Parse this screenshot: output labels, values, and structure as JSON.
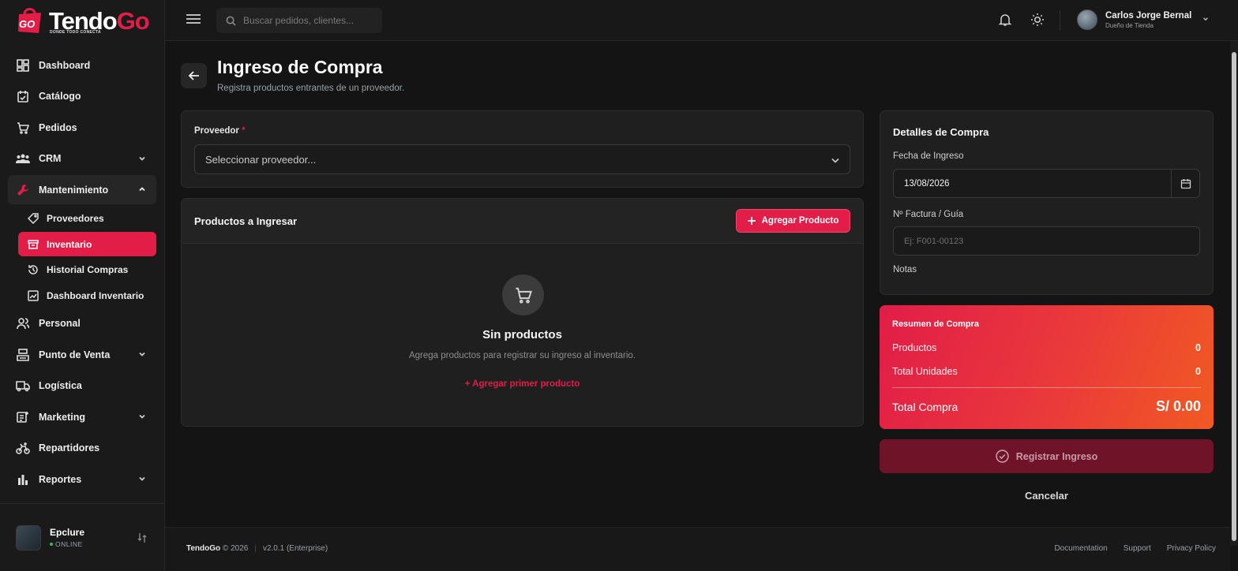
{
  "brand": {
    "name_a": "Tendo",
    "name_b": "Go",
    "badge": "GO",
    "tagline": "DONDE TODO CONECTA"
  },
  "topbar": {
    "search_placeholder": "Buscar pedidos, clientes...",
    "user_name": "Carlos Jorge Bernal",
    "user_role": "Dueño de Tienda"
  },
  "sidebar": {
    "items": [
      {
        "label": "Dashboard",
        "icon": "dashboard-icon"
      },
      {
        "label": "Catálogo",
        "icon": "catalog-icon"
      },
      {
        "label": "Pedidos",
        "icon": "cart-icon"
      },
      {
        "label": "CRM",
        "icon": "users-icon"
      },
      {
        "label": "Mantenimiento",
        "icon": "wrench-icon"
      }
    ],
    "sub_items": [
      {
        "label": "Proveedores",
        "icon": "tag-icon"
      },
      {
        "label": "Inventario",
        "icon": "archive-icon"
      },
      {
        "label": "Historial Compras",
        "icon": "history-icon"
      },
      {
        "label": "Dashboard Inventario",
        "icon": "chart-icon"
      }
    ],
    "items_after": [
      {
        "label": "Personal",
        "icon": "person-icon"
      },
      {
        "label": "Punto de Venta",
        "icon": "register-icon"
      },
      {
        "label": "Logística",
        "icon": "truck-icon"
      },
      {
        "label": "Marketing",
        "icon": "marketing-icon"
      },
      {
        "label": "Repartidores",
        "icon": "bike-icon"
      },
      {
        "label": "Reportes",
        "icon": "bar-chart-icon"
      }
    ],
    "store_name": "Epclure",
    "store_status": "ONLINE"
  },
  "page": {
    "title": "Ingreso de Compra",
    "subtitle": "Registra productos entrantes de un proveedor."
  },
  "supplier": {
    "label": "Proveedor",
    "required": "*",
    "placeholder": "Seleccionar proveedor..."
  },
  "products": {
    "title": "Productos a Ingresar",
    "add_button": "Agregar Producto",
    "empty_title": "Sin productos",
    "empty_text": "Agrega productos para registrar su ingreso al inventario.",
    "empty_link": "+ Agregar primer producto"
  },
  "details": {
    "title": "Detalles de Compra",
    "date_label": "Fecha de Ingreso",
    "date_value": "13/08/2026",
    "invoice_label": "Nº Factura / Guía",
    "invoice_placeholder": "Ej: F001-00123",
    "notes_label": "Notas"
  },
  "summary": {
    "title": "Resumen de Compra",
    "products_label": "Productos",
    "products_value": "0",
    "units_label": "Total Unidades",
    "units_value": "0",
    "total_label": "Total Compra",
    "total_value": "S/ 0.00"
  },
  "actions": {
    "register": "Registrar Ingreso",
    "cancel": "Cancelar"
  },
  "footer": {
    "brand": "TendoGo",
    "copyright": "© 2026",
    "version": "v2.0.1 (Enterprise)",
    "links": [
      "Documentation",
      "Support",
      "Privacy Policy"
    ]
  },
  "colors": {
    "accent": "#e11d48",
    "background": "#141414",
    "card": "#1f1f1f"
  }
}
